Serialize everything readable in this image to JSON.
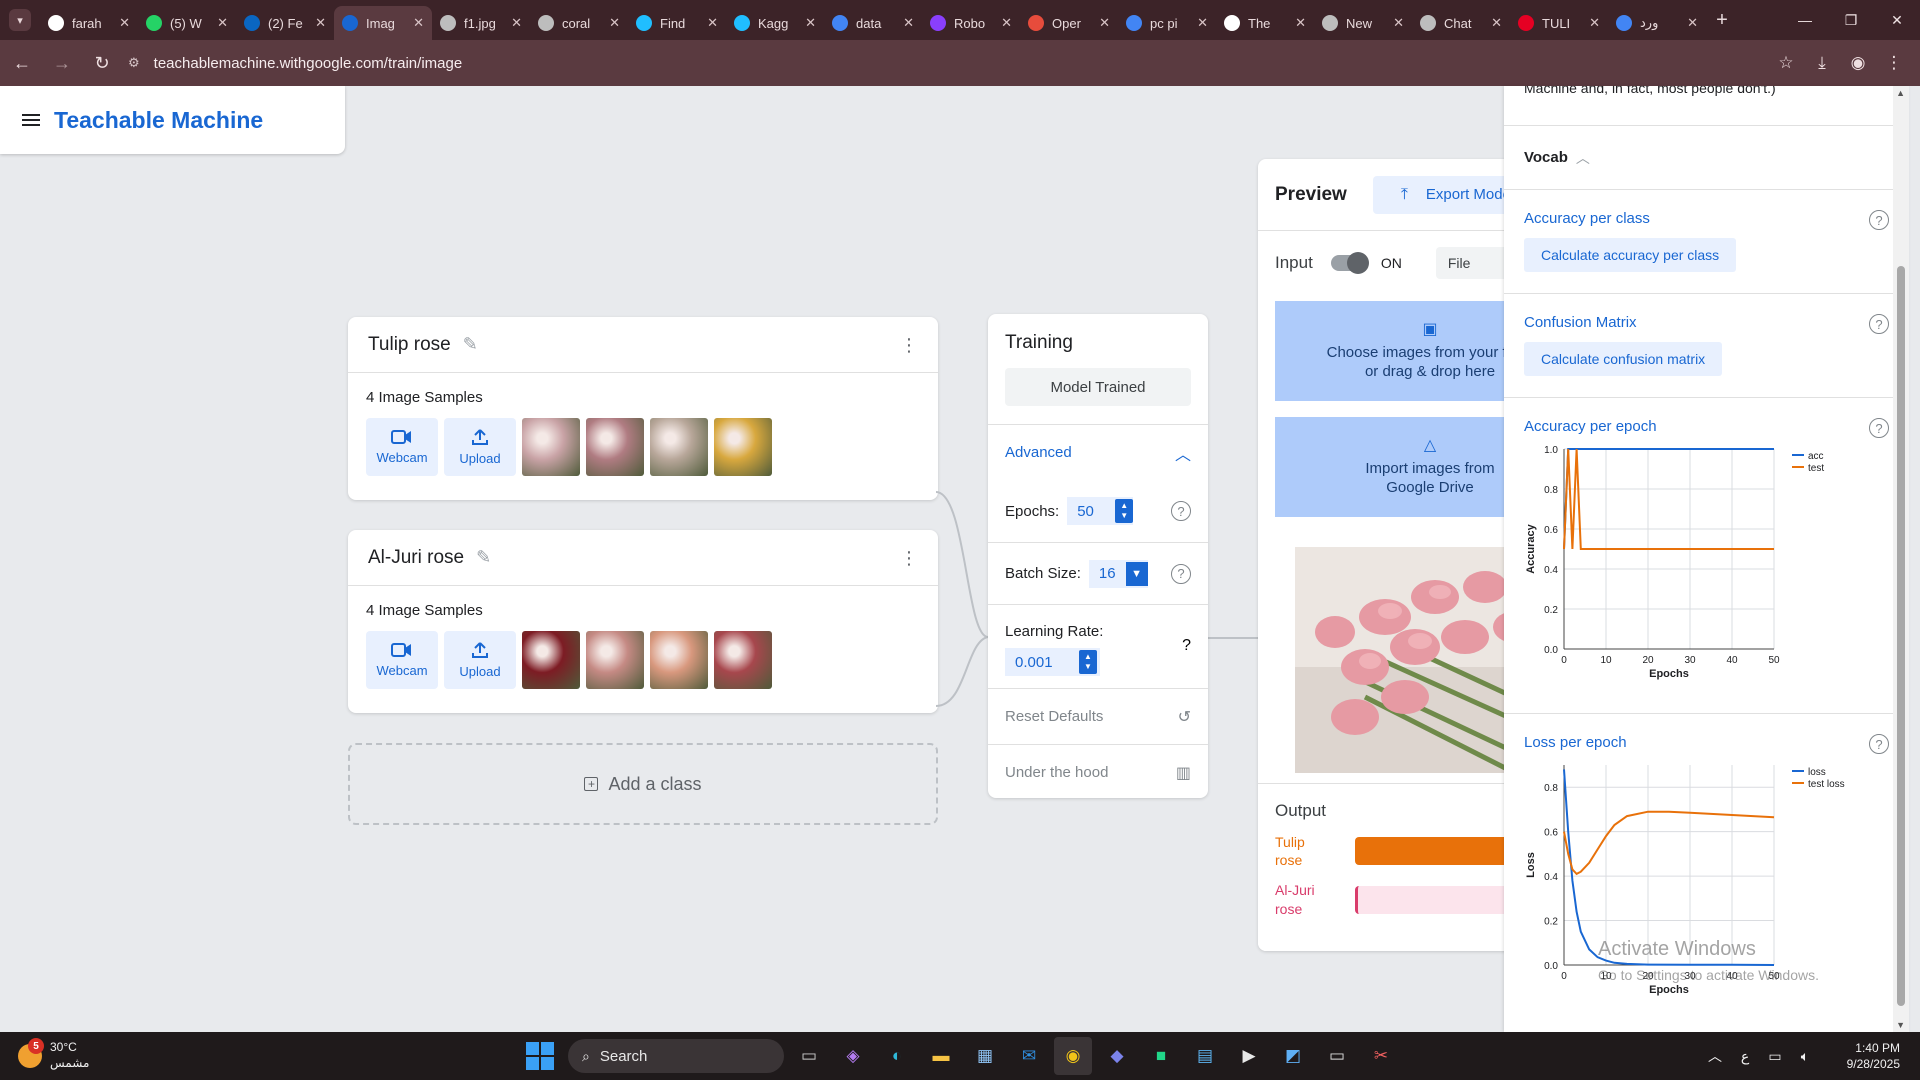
{
  "browser": {
    "tabs": [
      {
        "title": "farah",
        "icon": "github-icon",
        "color": "#ffffff"
      },
      {
        "title": "(5) W",
        "icon": "whatsapp-icon",
        "color": "#25d366"
      },
      {
        "title": "(2) Fe",
        "icon": "linkedin-icon",
        "color": "#0a66c2"
      },
      {
        "title": "Imag",
        "icon": "teachable-machine-icon",
        "color": "#1967d2",
        "active": true
      },
      {
        "title": "f1.jpg",
        "icon": "globe-icon",
        "color": "#bdbdbd"
      },
      {
        "title": "coral",
        "icon": "globe-icon",
        "color": "#bdbdbd"
      },
      {
        "title": "Find",
        "icon": "kaggle-icon",
        "color": "#20beff"
      },
      {
        "title": "Kagg",
        "icon": "kaggle-icon",
        "color": "#20beff"
      },
      {
        "title": "data",
        "icon": "google-icon",
        "color": "#4285f4"
      },
      {
        "title": "Robo",
        "icon": "roboflow-icon",
        "color": "#8a3ffc"
      },
      {
        "title": "Oper",
        "icon": "openverse-icon",
        "color": "#e74c3c"
      },
      {
        "title": "pc pi",
        "icon": "google-icon",
        "color": "#4285f4"
      },
      {
        "title": "The",
        "icon": "doc-icon",
        "color": "#ffffff"
      },
      {
        "title": "New",
        "icon": "globe-icon",
        "color": "#bdbdbd"
      },
      {
        "title": "Chat",
        "icon": "chatgpt-icon",
        "color": "#bdbdbd"
      },
      {
        "title": "TULI",
        "icon": "pinterest-icon",
        "color": "#e60023"
      },
      {
        "title": "ورد",
        "icon": "google-icon",
        "color": "#4285f4"
      }
    ],
    "url": "teachablemachine.withgoogle.com/train/image"
  },
  "app": {
    "title": "Teachable Machine"
  },
  "classes": [
    {
      "name": "Tulip rose",
      "samples_label": "4 Image Samples",
      "webcam_label": "Webcam",
      "upload_label": "Upload",
      "thumb_colors": [
        "#c9a3a6",
        "#b07c82",
        "#b8a79a",
        "#d8a83e"
      ]
    },
    {
      "name": "Al-Juri rose",
      "samples_label": "4 Image Samples",
      "webcam_label": "Webcam",
      "upload_label": "Upload",
      "thumb_colors": [
        "#7d1c24",
        "#c58a84",
        "#d8987e",
        "#a7474d"
      ]
    }
  ],
  "add_class_label": "Add a class",
  "training": {
    "title": "Training",
    "status": "Model Trained",
    "advanced_label": "Advanced",
    "epochs_label": "Epochs:",
    "epochs_value": "50",
    "batch_label": "Batch Size:",
    "batch_value": "16",
    "lr_label": "Learning Rate:",
    "lr_value": "0.001",
    "reset_label": "Reset Defaults",
    "hood_label": "Under the hood"
  },
  "preview": {
    "title": "Preview",
    "export_label": "Export Model",
    "input_label": "Input",
    "toggle_state": "ON",
    "file_label": "File",
    "choose_line1": "Choose images from your files,",
    "choose_line2": "or drag & drop here",
    "drive_line1": "Import images from",
    "drive_line2": "Google Drive",
    "output_title": "Output",
    "outputs": [
      {
        "label_line1": "Tulip",
        "label_line2": "rose",
        "color": "#e8710a",
        "bar_color": "#e8710a",
        "fraction": 1.0
      },
      {
        "label_line1": "Al-Juri",
        "label_line2": "rose",
        "color": "#d93c6b",
        "bar_color": "#fce4ec",
        "fraction": 0.0
      }
    ]
  },
  "side_panel": {
    "cut_text": "Machine and, in fact, most people don't.)",
    "vocab_label": "Vocab",
    "acc_class_title": "Accuracy per class",
    "acc_class_button": "Calculate accuracy per class",
    "confusion_title": "Confusion Matrix",
    "confusion_button": "Calculate confusion matrix",
    "acc_epoch_title": "Accuracy per epoch",
    "loss_epoch_title": "Loss per epoch"
  },
  "chart_data": [
    {
      "type": "line",
      "title": "",
      "xlabel": "Epochs",
      "ylabel": "Accuracy",
      "xlim": [
        0,
        50
      ],
      "ylim": [
        0,
        1.0
      ],
      "xticks": [
        0,
        10,
        20,
        30,
        40,
        50
      ],
      "yticks": [
        0.0,
        0.2,
        0.4,
        0.6,
        0.8,
        1.0
      ],
      "grid": true,
      "legend": "top-right",
      "series": [
        {
          "name": "acc",
          "color": "#1967d2",
          "x": [
            0,
            1,
            2,
            3,
            4,
            5,
            10,
            20,
            30,
            40,
            50
          ],
          "y": [
            0.5,
            1.0,
            1.0,
            1.0,
            1.0,
            1.0,
            1.0,
            1.0,
            1.0,
            1.0,
            1.0
          ]
        },
        {
          "name": "test",
          "color": "#e8710a",
          "x": [
            0,
            1,
            2,
            3,
            4,
            10,
            20,
            30,
            40,
            50
          ],
          "y": [
            0.5,
            1.0,
            0.5,
            1.0,
            0.5,
            0.5,
            0.5,
            0.5,
            0.5,
            0.5
          ]
        }
      ]
    },
    {
      "type": "line",
      "title": "",
      "xlabel": "Epochs",
      "ylabel": "Loss",
      "xlim": [
        0,
        50
      ],
      "ylim": [
        0,
        0.9
      ],
      "xticks": [
        0,
        10,
        20,
        30,
        40,
        50
      ],
      "yticks": [
        0.0,
        0.2,
        0.4,
        0.6,
        0.8
      ],
      "grid": true,
      "legend": "top-right",
      "series": [
        {
          "name": "loss",
          "color": "#1967d2",
          "x": [
            0,
            1,
            2,
            3,
            4,
            6,
            8,
            10,
            12,
            15,
            20,
            30,
            40,
            50
          ],
          "y": [
            0.88,
            0.6,
            0.38,
            0.24,
            0.15,
            0.07,
            0.035,
            0.02,
            0.01,
            0.005,
            0.002,
            0.001,
            0.001,
            0.0
          ]
        },
        {
          "name": "test loss",
          "color": "#e8710a",
          "x": [
            0,
            1,
            2,
            3,
            4,
            6,
            8,
            10,
            12,
            15,
            20,
            25,
            30,
            40,
            50
          ],
          "y": [
            0.6,
            0.5,
            0.43,
            0.41,
            0.42,
            0.46,
            0.52,
            0.58,
            0.63,
            0.67,
            0.69,
            0.69,
            0.685,
            0.675,
            0.665
          ]
        }
      ]
    }
  ],
  "watermark": {
    "line1": "Activate Windows",
    "line2": "Go to Settings to activate Windows."
  },
  "taskbar": {
    "temperature": "30°C",
    "weather_text": "مشمس",
    "weather_badge": "5",
    "search_label": "Search",
    "time": "1:40 PM",
    "date": "9/28/2025",
    "lang": "ع"
  }
}
